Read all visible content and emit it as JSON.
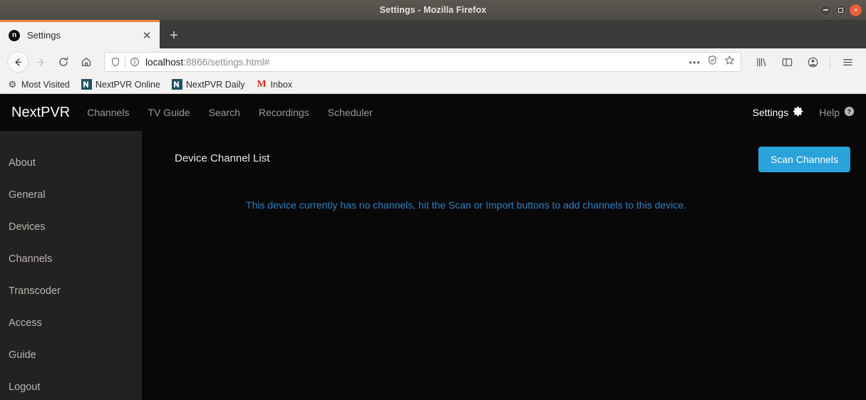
{
  "window": {
    "title": "Settings - Mozilla Firefox",
    "controls": {
      "minimize": "minimize",
      "maximize": "maximize",
      "close": "×"
    }
  },
  "browser": {
    "tab": {
      "favicon_letter": "n",
      "title": "Settings",
      "close_glyph": "✕"
    },
    "new_tab_glyph": "+",
    "toolbar": {
      "back_glyph": "←",
      "forward_glyph": "→",
      "reload_glyph": "⟳",
      "home_glyph": "⌂",
      "more_glyph": "•••"
    },
    "url": {
      "host": "localhost",
      "rest": ":8866/settings.html#",
      "full": "localhost:8866/settings.html#"
    },
    "bookmarks": [
      {
        "label": "Most Visited",
        "icon": "gear-icon",
        "glyph": "⚙"
      },
      {
        "label": "NextPVR Online",
        "icon": "nextpvr-icon",
        "glyph": "✔"
      },
      {
        "label": "NextPVR Daily",
        "icon": "nextpvr-icon",
        "glyph": "✔"
      },
      {
        "label": "Inbox",
        "icon": "gmail-icon",
        "glyph": "M"
      }
    ]
  },
  "app": {
    "brand": "NextPVR",
    "nav_links": [
      {
        "label": "Channels"
      },
      {
        "label": "TV Guide"
      },
      {
        "label": "Search"
      },
      {
        "label": "Recordings"
      },
      {
        "label": "Scheduler"
      }
    ],
    "nav_right": [
      {
        "label": "Settings",
        "icon": "gear-icon",
        "glyph": "⚙",
        "active": true
      },
      {
        "label": "Help",
        "icon": "help-circle-icon",
        "glyph": "?",
        "active": false
      }
    ],
    "sidebar": {
      "items": [
        {
          "label": "About"
        },
        {
          "label": "General"
        },
        {
          "label": "Devices"
        },
        {
          "label": "Channels"
        },
        {
          "label": "Transcoder"
        },
        {
          "label": "Access"
        },
        {
          "label": "Guide"
        },
        {
          "label": "Logout"
        }
      ]
    },
    "main": {
      "title": "Device Channel List",
      "scan_button": "Scan Channels",
      "empty_message": "This device currently has no channels, hit the Scan or Import buttons to add channels to this device."
    }
  },
  "colors": {
    "accent_blue": "#2aa3db",
    "message_blue": "#2e7fc1",
    "tab_accent": "#ef8344",
    "sidebar_bg": "#222222",
    "page_bg": "#080808"
  }
}
